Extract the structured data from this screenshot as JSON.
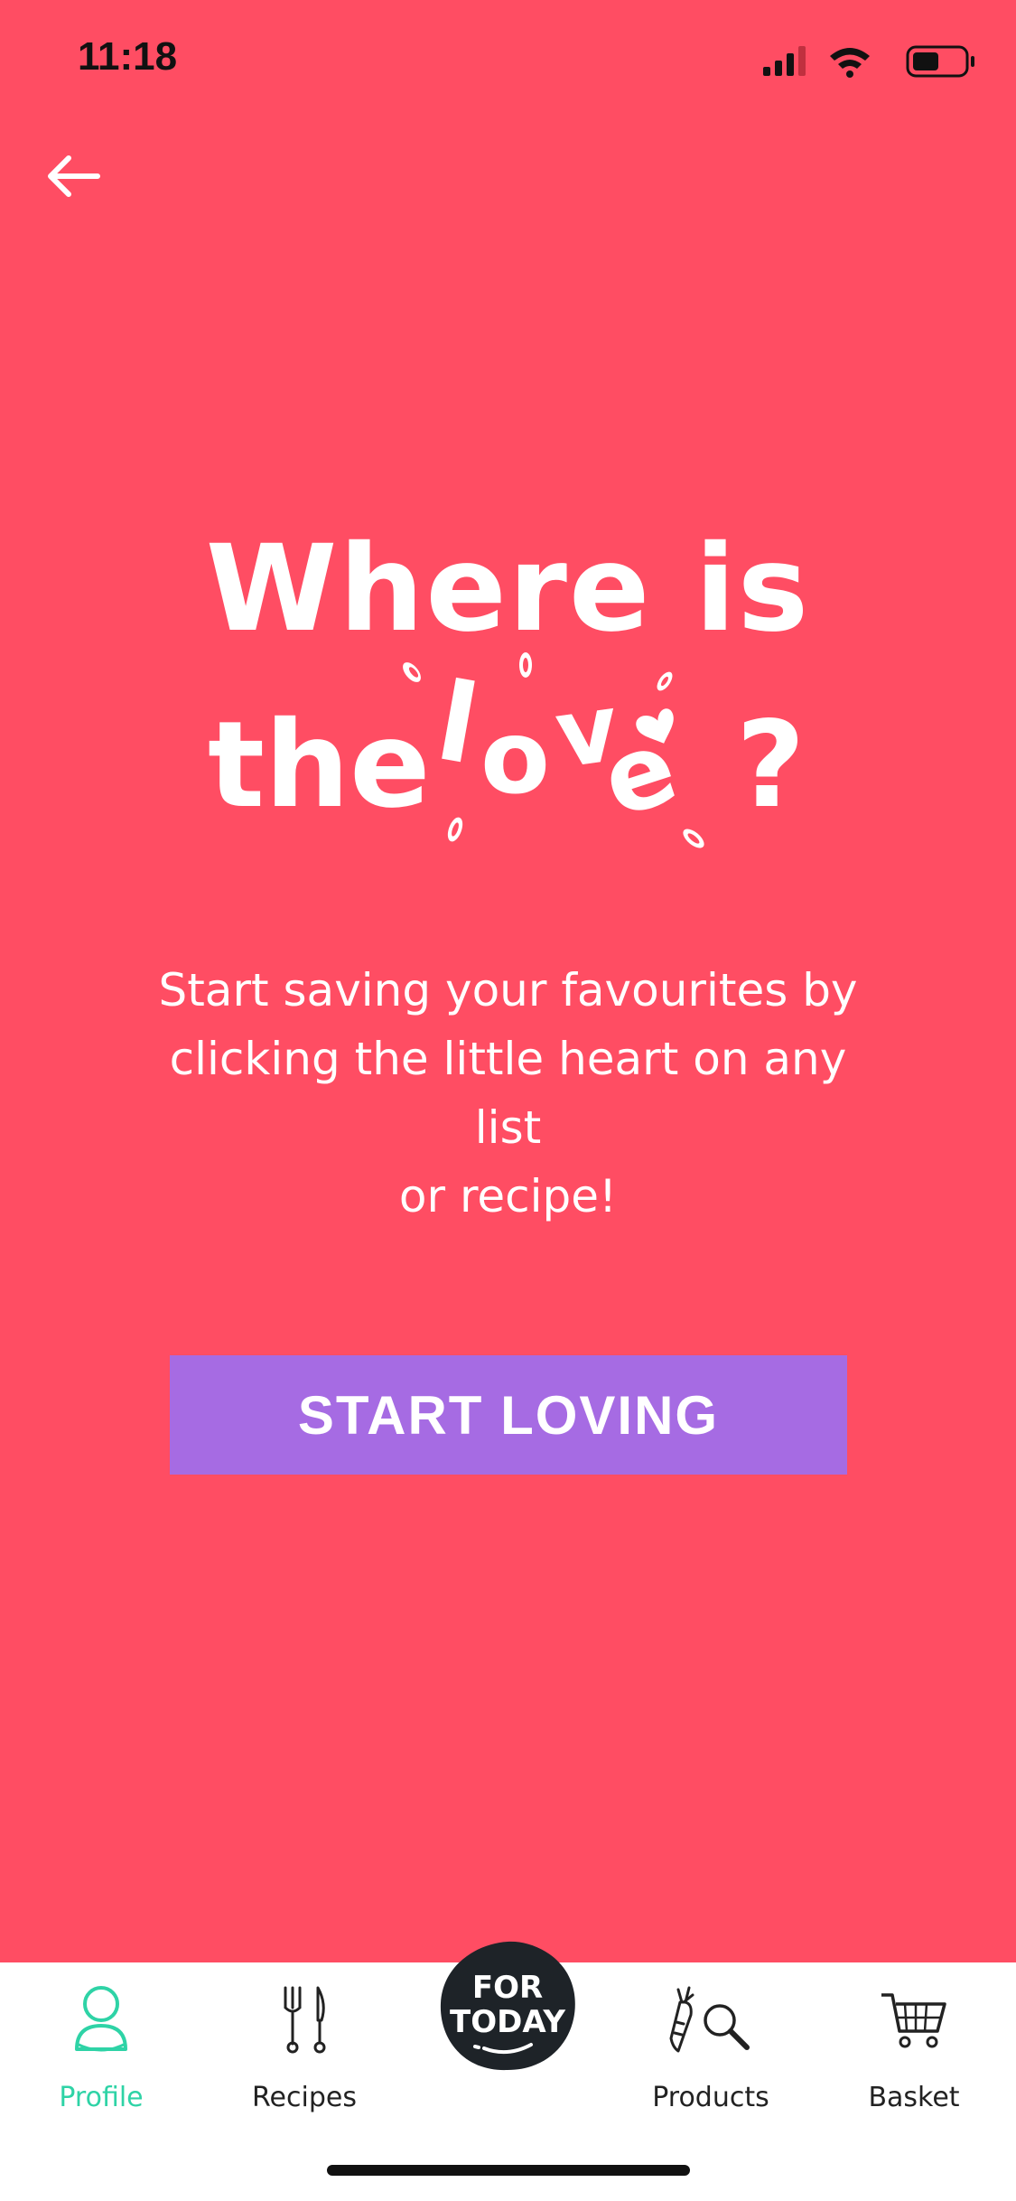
{
  "status_bar": {
    "time": "11:18"
  },
  "headline": {
    "line1": "Where is",
    "line2_prefix": "the",
    "love_letters": [
      "l",
      "o",
      "v",
      "e"
    ],
    "suffix": "?"
  },
  "body": {
    "line1": "Start saving your favourites by",
    "line2": "clicking the little heart on any list",
    "line3": "or recipe!"
  },
  "cta": {
    "label": "START LOVING"
  },
  "tabbar": {
    "tabs": [
      {
        "label": "Profile",
        "icon": "person-icon",
        "active": true
      },
      {
        "label": "Recipes",
        "icon": "fork-knife-icon",
        "active": false
      },
      {
        "label": "Products",
        "icon": "carrot-search-icon",
        "active": false
      },
      {
        "label": "Basket",
        "icon": "cart-icon",
        "active": false
      }
    ],
    "center": {
      "line1": "FOR",
      "line2": "TODAY"
    }
  },
  "colors": {
    "background": "#ff4d63",
    "button": "#a66be3",
    "active_tab": "#2ed3a6",
    "center_badge": "#1e2328"
  }
}
